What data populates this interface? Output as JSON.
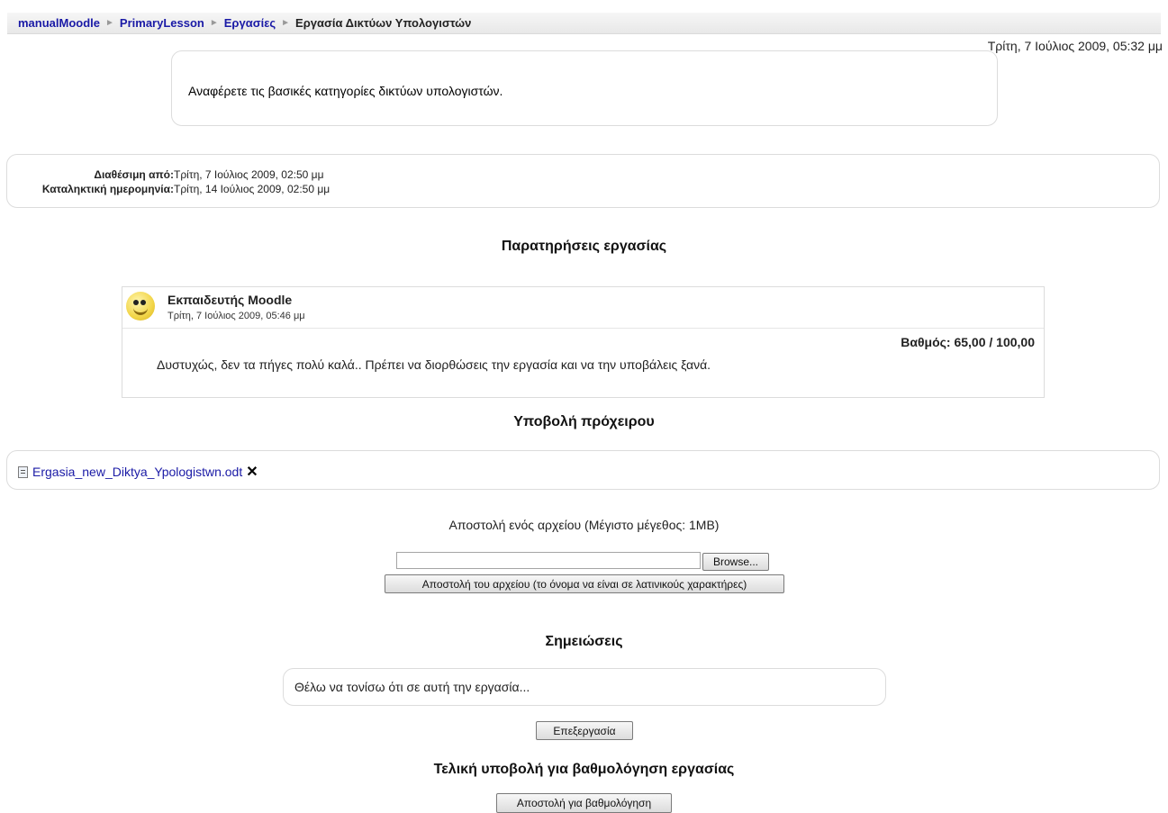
{
  "breadcrumb": {
    "items": [
      "manualMoodle",
      "PrimaryLesson",
      "Εργασίες"
    ],
    "current": "Εργασία Δικτύων Υπολογιστών",
    "separator": "►"
  },
  "datetime": "Τρίτη, 7 Ιούλιος 2009, 05:32 μμ",
  "intro_text": "Αναφέρετε τις βασικές κατηγορίες δικτύων υπολογιστών.",
  "dates": {
    "available_label": "Διαθέσιμη από:",
    "available_value": "Τρίτη, 7 Ιούλιος 2009, 02:50 μμ",
    "due_label": "Καταληκτική ημερομηνία:",
    "due_value": "Τρίτη, 14 Ιούλιος 2009, 02:50 μμ"
  },
  "feedback": {
    "heading": "Παρατηρήσεις εργασίας",
    "teacher": "Εκπαιδευτής Moodle",
    "date": "Τρίτη, 7 Ιούλιος 2009, 05:46 μμ",
    "grade": "Βαθμός: 65,00 / 100,00",
    "text": "Δυστυχώς, δεν τα πήγες πολύ καλά.. Πρέπει να διορθώσεις την εργασία και να την υποβάλεις ξανά."
  },
  "draft": {
    "heading": "Υποβολή πρόχειρου",
    "file_name": "Ergasia_new_Diktya_Ypologistwn.odt",
    "delete_symbol": "✕"
  },
  "upload": {
    "label": "Αποστολή ενός αρχείου (Μέγιστο μέγεθος: 1MB)",
    "browse": "Browse...",
    "send": "Αποστολή του αρχείου (το όνομα να είναι σε λατινικούς χαρακτήρες)"
  },
  "notes": {
    "heading": "Σημειώσεις",
    "text": "Θέλω να τονίσω ότι σε αυτή την εργασία...",
    "edit": "Επεξεργασία"
  },
  "final": {
    "heading": "Τελική υποβολή για βαθμολόγηση εργασίας",
    "submit": "Αποστολή για βαθμολόγηση"
  }
}
